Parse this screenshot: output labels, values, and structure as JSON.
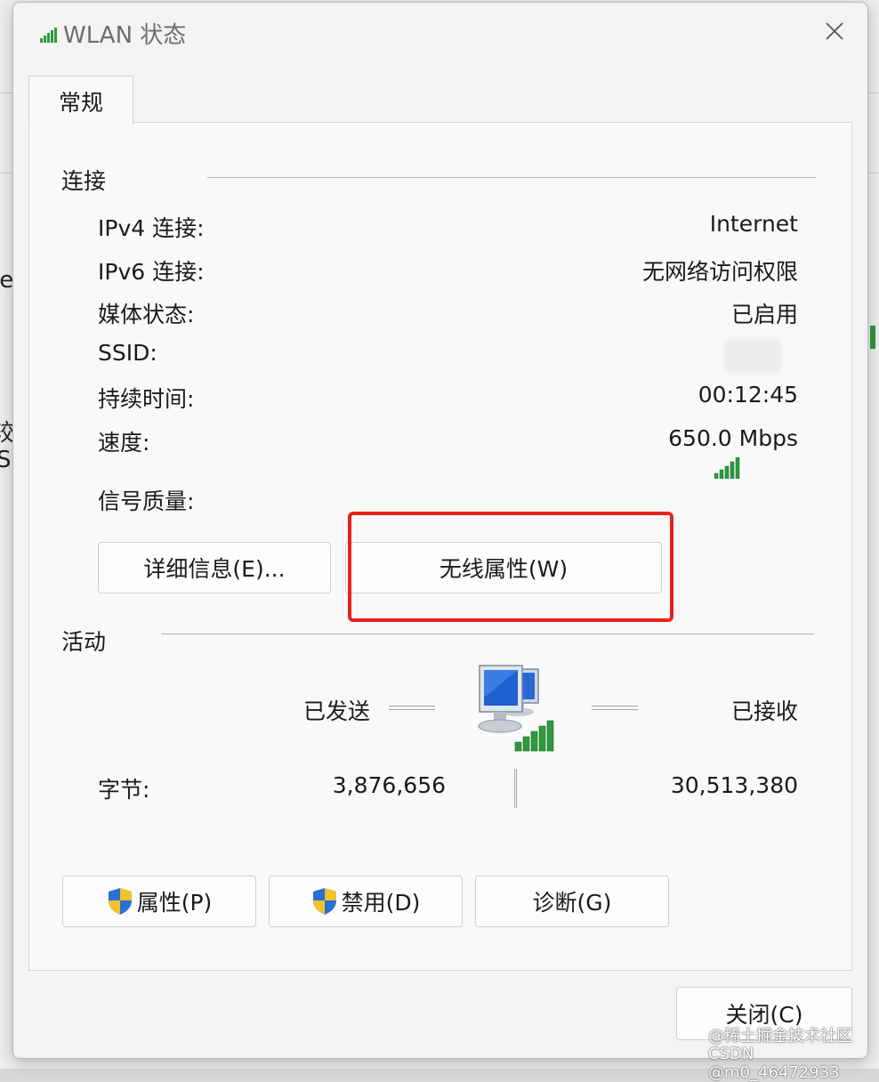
{
  "window": {
    "title": "WLAN 状态",
    "close_icon": "close-icon"
  },
  "tabs": [
    {
      "label": "常规"
    }
  ],
  "connection": {
    "group_title": "连接",
    "rows": [
      {
        "label": "IPv4 连接:",
        "value": "Internet"
      },
      {
        "label": "IPv6 连接:",
        "value": "无网络访问权限"
      },
      {
        "label": "媒体状态:",
        "value": "已启用"
      },
      {
        "label": "SSID:",
        "value": ""
      },
      {
        "label": "持续时间:",
        "value": "00:12:45"
      },
      {
        "label": "速度:",
        "value": "650.0 Mbps"
      }
    ],
    "signal_label": "信号质量:",
    "signal_level": 5,
    "signal_max": 5,
    "details_button": "详细信息(E)...",
    "wireless_button": "无线属性(W)"
  },
  "activity": {
    "group_title": "活动",
    "sent_label": "已发送",
    "received_label": "已接收",
    "bytes_label": "字节:",
    "bytes_sent": "3,876,656",
    "bytes_received": "30,513,380"
  },
  "actions": {
    "properties_button": "属性(P)",
    "disable_button": "禁用(D)",
    "diagnose_button": "诊断(G)",
    "close_button": "关闭(C)"
  },
  "watermark": {
    "line1": "@稀土掘金技术社区",
    "line2": "CSDN @m0_46472933"
  },
  "background_fragments": [
    "le",
    "较",
    "S"
  ],
  "colors": {
    "highlight": "#e8211c",
    "signal": "#2e9a3c",
    "shield_blue": "#2a6fd6",
    "shield_yellow": "#f2c12e"
  }
}
